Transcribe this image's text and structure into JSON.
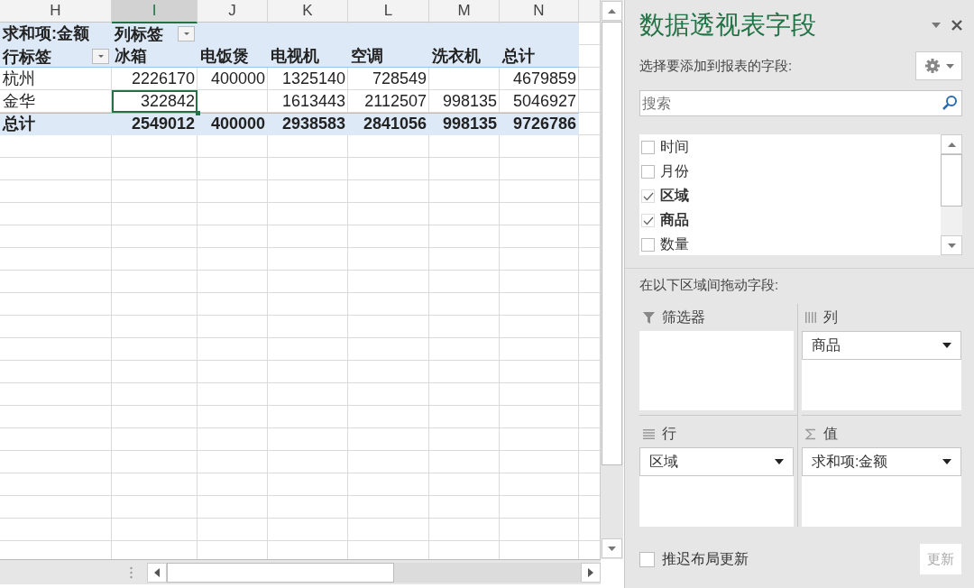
{
  "sheet": {
    "columns": [
      {
        "label": "H",
        "selected": false
      },
      {
        "label": "I",
        "selected": true
      },
      {
        "label": "J",
        "selected": false
      },
      {
        "label": "K",
        "selected": false
      },
      {
        "label": "L",
        "selected": false
      },
      {
        "label": "M",
        "selected": false
      },
      {
        "label": "N",
        "selected": false
      }
    ]
  },
  "pivot": {
    "value_field": "求和项:金额",
    "column_label": "列标签",
    "row_label": "行标签",
    "headers": [
      "冰箱",
      "电饭煲",
      "电视机",
      "空调",
      "洗衣机",
      "总计"
    ],
    "rows": [
      {
        "kind": "data",
        "label": "杭州",
        "cells": [
          {
            "text": "2226170",
            "selected": false
          },
          {
            "text": "400000",
            "selected": false
          },
          {
            "text": "1325140",
            "selected": false
          },
          {
            "text": "728549",
            "selected": false
          },
          {
            "selected": false
          },
          {
            "text": "4679859",
            "selected": false
          }
        ]
      },
      {
        "kind": "data",
        "label": "金华",
        "cells": [
          {
            "text": "322842",
            "selected": true
          },
          {
            "selected": false
          },
          {
            "text": "1613443",
            "selected": false
          },
          {
            "text": "2112507",
            "selected": false
          },
          {
            "text": "998135",
            "selected": false
          },
          {
            "text": "5046927",
            "selected": false
          }
        ]
      },
      {
        "kind": "total",
        "label": "总计",
        "cells": [
          {
            "text": "2549012",
            "selected": false
          },
          {
            "text": "400000",
            "selected": false
          },
          {
            "text": "2938583",
            "selected": false
          },
          {
            "text": "2841056",
            "selected": false
          },
          {
            "text": "998135",
            "selected": false
          },
          {
            "text": "9726786",
            "selected": false
          }
        ]
      }
    ]
  },
  "panel": {
    "title": "数据透视表字段",
    "subtitle": "选择要添加到报表的字段:",
    "search": {
      "placeholder": "搜索"
    },
    "fields": [
      {
        "label": "时间",
        "checked": false
      },
      {
        "label": "月份",
        "checked": false
      },
      {
        "label": "区域",
        "checked": true
      },
      {
        "label": "商品",
        "checked": true
      },
      {
        "label": "数量",
        "checked": false
      }
    ],
    "areas_hint": "在以下区域间拖动字段:",
    "areas": [
      {
        "kind": "filter",
        "label": "筛选器"
      },
      {
        "kind": "columns",
        "label": "列",
        "items": [
          "商品"
        ]
      },
      {
        "kind": "rows",
        "label": "行",
        "items": [
          "区域"
        ]
      },
      {
        "kind": "values",
        "label": "值",
        "items": [
          "求和项:金额"
        ]
      }
    ],
    "defer_update": {
      "label": "推迟布局更新",
      "checked": false
    },
    "update_button": {
      "label": "更新",
      "disabled": true
    }
  }
}
